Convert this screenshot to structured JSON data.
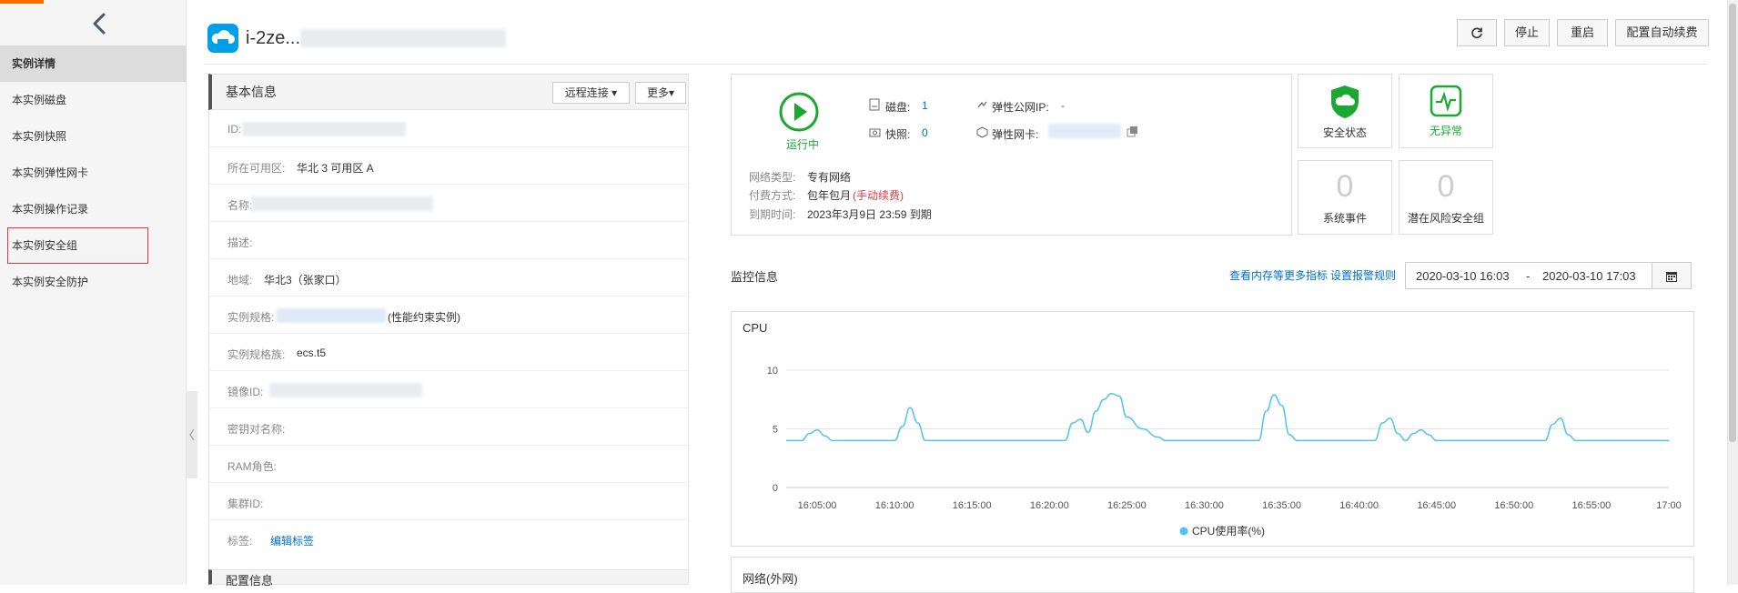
{
  "sidebar": {
    "items": [
      {
        "label": "实例详情",
        "active": true
      },
      {
        "label": "本实例磁盘"
      },
      {
        "label": "本实例快照"
      },
      {
        "label": "本实例弹性网卡"
      },
      {
        "label": "本实例操作记录"
      },
      {
        "label": "本实例安全组"
      },
      {
        "label": "本实例安全防护"
      }
    ]
  },
  "header": {
    "title_visible": "i-2ze...",
    "actions": {
      "refresh_icon": "refresh-icon",
      "stop": "停止",
      "restart": "重启",
      "auto_renew": "配置自动续费"
    }
  },
  "basic_info": {
    "title": "基本信息",
    "remote_connect": "远程连接",
    "more": "更多",
    "fields": {
      "id_label": "ID:",
      "zone_label": "所在可用区:",
      "zone_value": "华北 3 可用区 A",
      "name_label": "名称:",
      "desc_label": "描述:",
      "region_label": "地域:",
      "region_value": "华北3（张家口）",
      "spec_label": "实例规格:",
      "spec_suffix": "(性能约束实例)",
      "family_label": "实例规格族:",
      "family_value": "ecs.t5",
      "image_label": "镜像ID:",
      "keypair_label": "密钥对名称:",
      "ram_label": "RAM角色:",
      "cluster_label": "集群ID:",
      "tag_label": "标签:",
      "tag_link": "编辑标签"
    }
  },
  "config_info": {
    "title": "配置信息"
  },
  "status": {
    "running": "运行中",
    "disk_label": "磁盘:",
    "disk_value": "1",
    "snapshot_label": "快照:",
    "snapshot_value": "0",
    "eip_label": "弹性公网IP:",
    "eip_value": "-",
    "eni_label": "弹性网卡:",
    "network_type_label": "网络类型:",
    "network_type_value": "专有网络",
    "billing_label": "付费方式:",
    "billing_value": "包年包月",
    "billing_renew": "(手动续费)",
    "expire_label": "到期时间:",
    "expire_value": "2023年3月9日 23:59 到期"
  },
  "tiles": {
    "security_label": "安全状态",
    "health_label": "无异常",
    "events_value": "0",
    "events_label": "系统事件",
    "risk_value": "0",
    "risk_label": "潜在风险安全组"
  },
  "monitor": {
    "title": "监控信息",
    "more_metrics": "查看内存等更多指标",
    "alarm_rules": "设置报警规则",
    "range_start": "2020-03-10 16:03",
    "range_sep": "-",
    "range_end": "2020-03-10 17:03"
  },
  "colors": {
    "accent": "#0070cc",
    "running": "#1aa832",
    "chart_line": "#4fc3f7"
  },
  "chart_data": {
    "type": "line",
    "title": "CPU",
    "xlabel": "",
    "ylabel": "",
    "ylim": [
      0,
      10
    ],
    "yticks": [
      0,
      5,
      10
    ],
    "xticks": [
      "16:05:00",
      "16:10:00",
      "16:15:00",
      "16:20:00",
      "16:25:00",
      "16:30:00",
      "16:35:00",
      "16:40:00",
      "16:45:00",
      "16:50:00",
      "16:55:00",
      "17:00"
    ],
    "grid": true,
    "legend": "bottom",
    "series": [
      {
        "name": "CPU使用率(%)",
        "x": [
          3,
          4,
          4.5,
          5,
          5.5,
          6,
          10,
          10.5,
          11,
          11.5,
          12,
          21,
          21.5,
          22,
          22.5,
          23,
          23.5,
          24,
          24.5,
          25,
          26,
          27,
          27.5,
          28,
          33.5,
          34,
          34.5,
          35,
          35.5,
          36,
          41,
          41.5,
          42,
          42.5,
          43,
          43.5,
          44,
          44.5,
          45,
          52,
          52.5,
          53,
          53.5,
          54,
          60
        ],
        "y": [
          4,
          4,
          4.6,
          4.9,
          4.4,
          4,
          4,
          5.2,
          6.8,
          5.5,
          4,
          4,
          5.5,
          5.8,
          4.7,
          6.5,
          7.5,
          8,
          7.8,
          6,
          5,
          4.3,
          4,
          4,
          4,
          6.5,
          7.9,
          7,
          4.5,
          4,
          4,
          5.5,
          5.9,
          4.6,
          4,
          4.6,
          4.9,
          4.5,
          4,
          4,
          5.4,
          5.9,
          4.5,
          4,
          4
        ]
      }
    ]
  }
}
